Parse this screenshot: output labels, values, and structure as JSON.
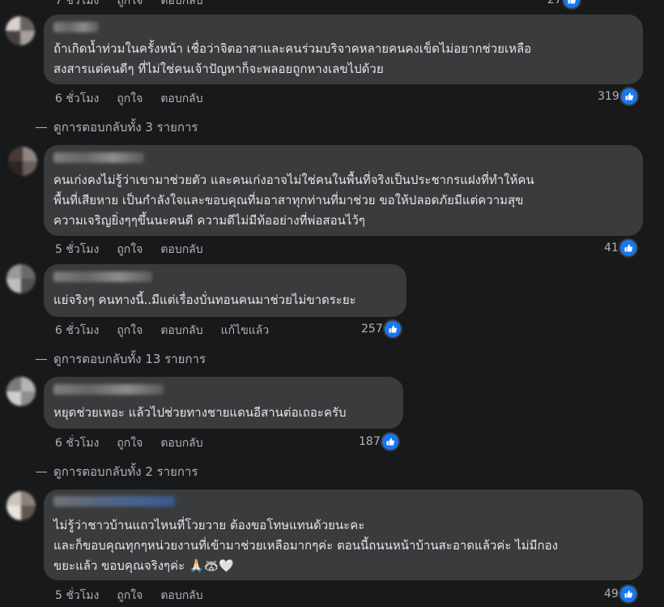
{
  "top_partial": {
    "meta": [
      "7 ชั่วโมง",
      "ถูกใจ",
      "ตอบกลับ"
    ],
    "count": "27"
  },
  "comments": [
    {
      "lines": [
        "ถ้าเกิดน้ำท่วมในครั้งหน้า เชื่อว่าจิตอาสาและคนร่วมบริจาคหลายคนคงเข็ดไม่อยากช่วยเหลือ",
        "สงสารแต่คนดีๆ ที่ไม่ใช่คนเจ้าปัญหาก็จะพลอยถูกหางเลขไปด้วย"
      ],
      "time": "6 ชั่วโมง",
      "like": "ถูกใจ",
      "reply": "ตอบกลับ",
      "reactions": "319",
      "view_replies": "ดูการตอบกลับทั้ง 3 รายการ"
    },
    {
      "lines": [
        "คนเก่งคงไม่รู้ว่าเขามาช่วยตัว และคนเก่งอาจไม่ใช่คนในพื้นที่จริงเป็นประชากรแฝงที่ทำให้คน",
        "พื้นที่เสียหาย เป็นกำลังใจและขอบคุณที่มอาสาทุกท่านที่มาช่วย ขอให้ปลอดภัยมีแต่ความสุข",
        "ความเจริญยิ่งๆๆขึ้นนะคนดี ความดีไม่มีท้ออย่างที่พ่อสอนไว้ๆ"
      ],
      "time": "5 ชั่วโมง",
      "like": "ถูกใจ",
      "reply": "ตอบกลับ",
      "reactions": "41"
    },
    {
      "lines": [
        "แย่จริงๆ คนทางนี้..มีแต่เรื่องบั่นทอนคนมาช่วยไม่ขาดระยะ"
      ],
      "time": "6 ชั่วโมง",
      "like": "ถูกใจ",
      "reply": "ตอบกลับ",
      "edited": "แก้ไขแล้ว",
      "reactions": "257",
      "view_replies": "ดูการตอบกลับทั้ง 13 รายการ"
    },
    {
      "lines": [
        "หยุดช่วยเหอะ แล้วไปช่วยทางชายแดนอีสานต่อเถอะครับ"
      ],
      "time": "6 ชั่วโมง",
      "like": "ถูกใจ",
      "reply": "ตอบกลับ",
      "reactions": "187",
      "view_replies": "ดูการตอบกลับทั้ง 2 รายการ"
    },
    {
      "lines": [
        "ไม่รู้ว่าชาวบ้านแถวไหนที่โวยวาย ต้องขอโทษแทนด้วยนะคะ",
        "และก็ขอบคุณทุกๆหน่วยงานที่เข้ามาช่วยเหลือมากๆค่ะ ตอนนี้ถนนหน้าบ้านสะอาดแล้วค่ะ ไม่มีกอง",
        "ขยะแล้ว ขอบคุณจริงๆค่ะ"
      ],
      "emojis": [
        "🙏🏻",
        "🦝",
        "🤍"
      ],
      "time": "5 ชั่วโมง",
      "like": "ถูกใจ",
      "reply": "ตอบกลับ",
      "reactions": "49"
    }
  ]
}
